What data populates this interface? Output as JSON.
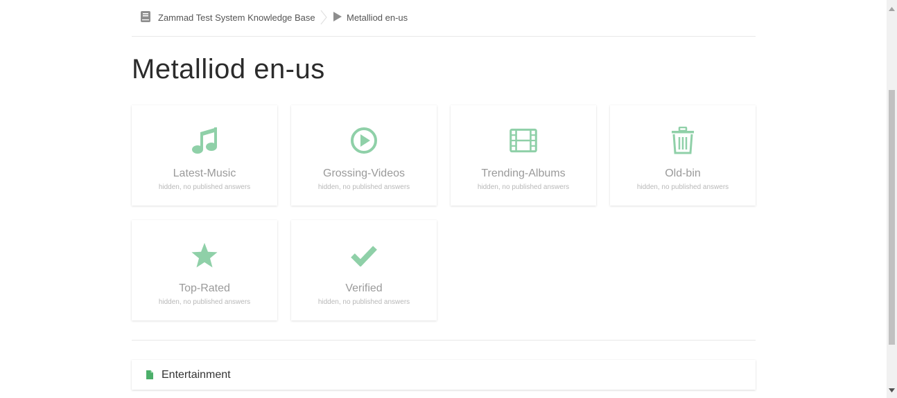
{
  "breadcrumb": {
    "kb_label": "Zammad Test System Knowledge Base",
    "kb_icon": "book-icon",
    "category_label": "Metalliod en-us",
    "category_icon": "play-icon"
  },
  "page_title": "Metalliod en-us",
  "categories": [
    {
      "name": "Latest-Music",
      "status": "hidden, no published answers",
      "icon": "music-note-icon"
    },
    {
      "name": "Grossing-Videos",
      "status": "hidden, no published answers",
      "icon": "play-circle-icon"
    },
    {
      "name": "Trending-Albums",
      "status": "hidden, no published answers",
      "icon": "film-icon"
    },
    {
      "name": "Old-bin",
      "status": "hidden, no published answers",
      "icon": "trash-icon"
    },
    {
      "name": "Top-Rated",
      "status": "hidden, no published answers",
      "icon": "star-icon"
    },
    {
      "name": "Verified",
      "status": "hidden, no published answers",
      "icon": "checkmark-icon"
    }
  ],
  "answers": [
    {
      "label": "Entertainment",
      "icon": "document-icon"
    }
  ],
  "colors": {
    "accent": "#8fd0a8",
    "document_icon": "#4caf6a",
    "text_muted": "#9a9a9a"
  }
}
